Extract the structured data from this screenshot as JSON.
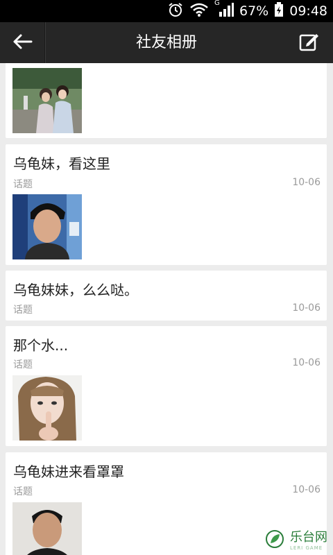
{
  "status_bar": {
    "network_label": "G",
    "battery": "67%",
    "time": "09:48"
  },
  "header": {
    "title": "社友相册"
  },
  "posts": [
    {
      "title": "",
      "tag": "",
      "date": "",
      "photo": "two-girls-photo"
    },
    {
      "title": "乌龟妹，看这里",
      "tag": "话题",
      "date": "10-06",
      "photo": "young-man-selfie"
    },
    {
      "title": "乌龟妹妹，么么哒。",
      "tag": "话题",
      "date": "10-06",
      "photo": ""
    },
    {
      "title": "那个水...",
      "tag": "话题",
      "date": "10-06",
      "photo": "girl-gesture-photo"
    },
    {
      "title": "乌龟妹进来看罩罩",
      "tag": "话题",
      "date": "10-06",
      "photo": "man-portrait-photo"
    }
  ],
  "watermark": {
    "text": "乐台网",
    "sub": "LERI GAME"
  },
  "colors": {
    "title_bar": "#262626",
    "status_bar": "#000000",
    "background": "#ececec",
    "card": "#ffffff",
    "meta_text": "#9a9a9a"
  }
}
